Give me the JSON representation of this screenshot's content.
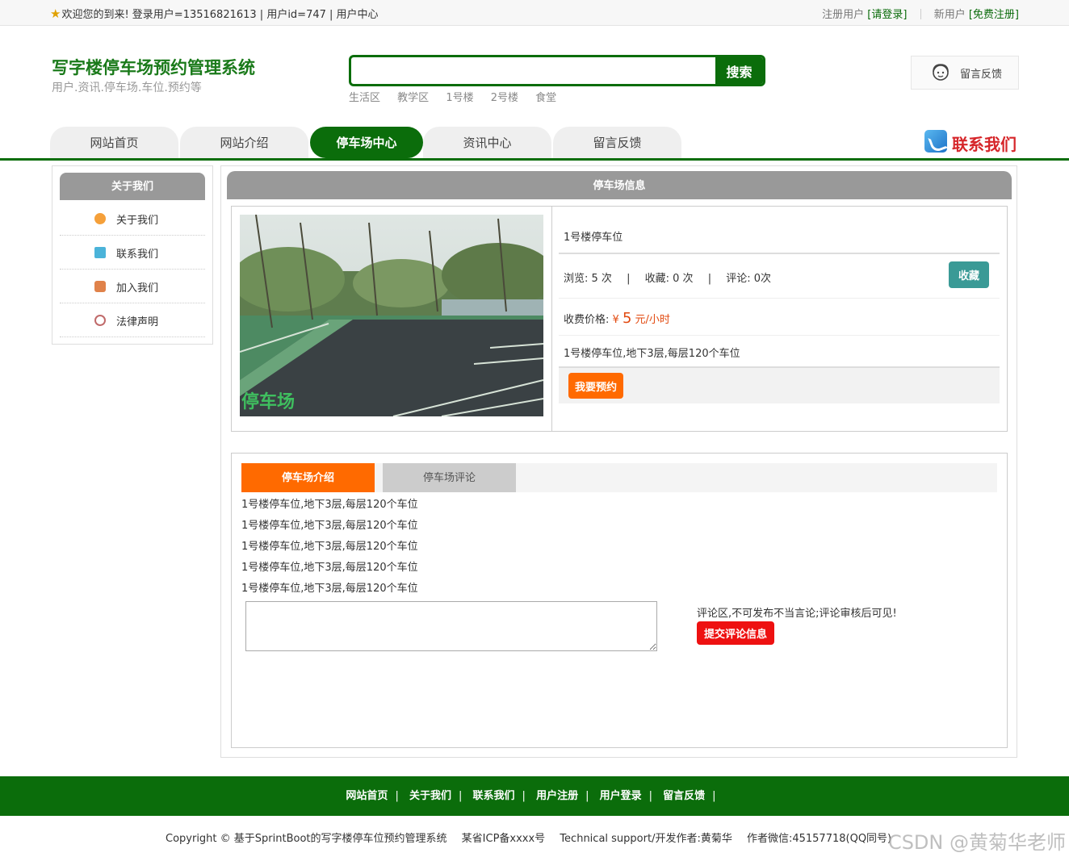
{
  "topbar": {
    "welcome": "欢迎您的到来!  登录用户=13516821613 | 用户id=747 | 用户中心",
    "registered_label": "注册用户",
    "login_link": "[请登录]",
    "new_user_label": "新用户",
    "signup_link": "[免费注册]"
  },
  "header": {
    "title": "写字楼停车场预约管理系统",
    "subtitle": "用户.资讯.停车场.车位.预约等",
    "search_value": "",
    "search_button": "搜索",
    "hot_keywords": [
      "生活区",
      "教学区",
      "1号楼",
      "2号楼",
      "食堂"
    ],
    "feedback_label": "留言反馈"
  },
  "nav": {
    "items": [
      "网站首页",
      "网站介绍",
      "停车场中心",
      "资讯中心",
      "留言反馈"
    ],
    "active": "停车场中心",
    "contact": "联系我们"
  },
  "sidebar": {
    "title": "关于我们",
    "items": [
      {
        "label": "关于我们",
        "icon": "orange-circle-icon",
        "color": "#f5a03a"
      },
      {
        "label": "联系我们",
        "icon": "clipboard-icon",
        "color": "#4bb3d9"
      },
      {
        "label": "加入我们",
        "icon": "lock-icon",
        "color": "#e0824a"
      },
      {
        "label": "法律声明",
        "icon": "power-icon",
        "color": "#c06a6a"
      }
    ]
  },
  "parking": {
    "panel_title": "停车场信息",
    "image_caption": "停车场",
    "name": "1号楼停车位",
    "views_label": "浏览:",
    "views": "5 次",
    "fav_label": "收藏:",
    "fav": "0 次",
    "comment_label": "评论:",
    "comments": "0次",
    "fav_button": "收藏",
    "price_label": "收费价格:",
    "price_currency": "¥",
    "price_value": "5",
    "price_unit": "元/小时",
    "description": "1号楼停车位,地下3层,每层120个车位",
    "book_button": "我要预约"
  },
  "tabs": {
    "intro_tab": "停车场介绍",
    "comment_tab": "停车场评论",
    "intro_lines": [
      "1号楼停车位,地下3层,每层120个车位",
      "1号楼停车位,地下3层,每层120个车位",
      "1号楼停车位,地下3层,每层120个车位",
      "1号楼停车位,地下3层,每层120个车位",
      "1号楼停车位,地下3层,每层120个车位"
    ],
    "comment_value": "",
    "comment_note": "评论区,不可发布不当言论;评论审核后可见!",
    "submit_button": "提交评论信息"
  },
  "footer": {
    "links": [
      "网站首页",
      "关于我们",
      "联系我们",
      "用户注册",
      "用户登录",
      "留言反馈"
    ],
    "copyright": "Copyright © 基于SprintBoot的写字楼停车位预约管理系统",
    "icp": "某省ICP备xxxx号",
    "support": "Technical support/开发作者:黄菊华",
    "wechat": "作者微信:45157718(QQ同号)",
    "watermark": "CSDN @黄菊华老师"
  },
  "colors": {
    "brand_green": "#0b6d0b",
    "accent_orange": "#ff6a00",
    "teal": "#3a9a96",
    "red": "#ee1111"
  }
}
